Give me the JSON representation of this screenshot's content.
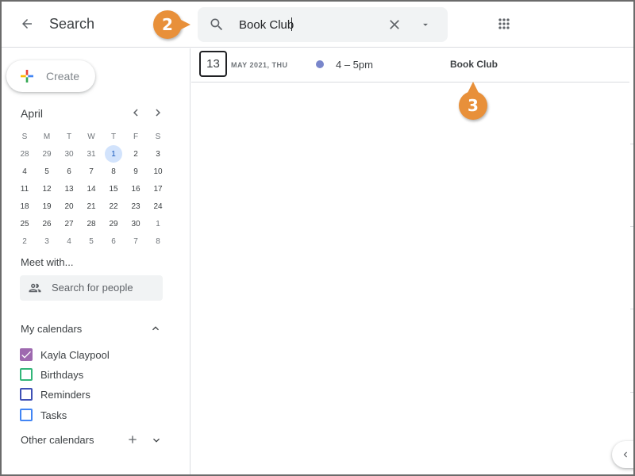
{
  "header": {
    "title": "Search",
    "search_value": "Book Club",
    "back_icon": "arrow-left-icon",
    "search_icon": "search-icon",
    "clear_icon": "close-icon",
    "options_icon": "caret-down-icon",
    "apps_icon": "apps-grid-icon"
  },
  "sidebar": {
    "create_label": "Create",
    "mini_calendar": {
      "month": "April",
      "weekdays": [
        "S",
        "M",
        "T",
        "W",
        "T",
        "F",
        "S"
      ],
      "weeks": [
        [
          "28",
          "29",
          "30",
          "31",
          "1",
          "2",
          "3"
        ],
        [
          "4",
          "5",
          "6",
          "7",
          "8",
          "9",
          "10"
        ],
        [
          "11",
          "12",
          "13",
          "14",
          "15",
          "16",
          "17"
        ],
        [
          "18",
          "19",
          "20",
          "21",
          "22",
          "23",
          "24"
        ],
        [
          "25",
          "26",
          "27",
          "28",
          "29",
          "30",
          "1"
        ],
        [
          "2",
          "3",
          "4",
          "5",
          "6",
          "7",
          "8"
        ]
      ],
      "highlighted_day": "1"
    },
    "meet_with": {
      "title": "Meet with...",
      "placeholder": "Search for people"
    },
    "my_calendars": {
      "title": "My calendars",
      "items": [
        {
          "label": "Kayla Claypool",
          "checked": true,
          "color": "#9e69af"
        },
        {
          "label": "Birthdays",
          "checked": false,
          "color": "#33b679"
        },
        {
          "label": "Reminders",
          "checked": false,
          "color": "#3f51b5"
        },
        {
          "label": "Tasks",
          "checked": false,
          "color": "#4285f4"
        }
      ]
    },
    "other_calendars": {
      "title": "Other calendars"
    }
  },
  "results": [
    {
      "day": "13",
      "date_label": "MAY 2021, THU",
      "time": "4 – 5pm",
      "title": "Book Club",
      "color": "#7986cb"
    }
  ],
  "callouts": [
    "2",
    "3"
  ],
  "colors": {
    "callout": "#e8903a",
    "today_bg": "#d2e3fc"
  }
}
